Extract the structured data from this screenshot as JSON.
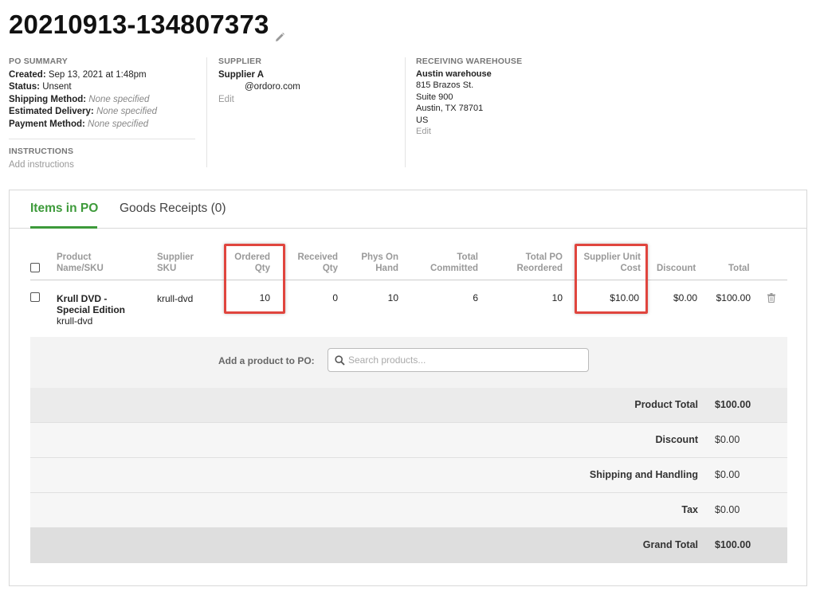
{
  "po": {
    "number": "20210913-134807373",
    "summary": {
      "heading": "PO SUMMARY",
      "created_label": "Created:",
      "created_value": "Sep 13, 2021 at 1:48pm",
      "status_label": "Status:",
      "status_value": "Unsent",
      "shipping_label": "Shipping Method:",
      "shipping_value": "None specified",
      "delivery_label": "Estimated Delivery:",
      "delivery_value": "None specified",
      "payment_label": "Payment Method:",
      "payment_value": "None specified"
    },
    "instructions": {
      "heading": "INSTRUCTIONS",
      "link": "Add instructions"
    },
    "supplier": {
      "heading": "SUPPLIER",
      "name": "Supplier A",
      "email": "@ordoro.com",
      "edit": "Edit"
    },
    "warehouse": {
      "heading": "RECEIVING WAREHOUSE",
      "name": "Austin warehouse",
      "line1": "815 Brazos St.",
      "line2": "Suite 900",
      "line3": "Austin, TX 78701",
      "line4": "US",
      "edit": "Edit"
    }
  },
  "tabs": [
    {
      "label": "Items in PO",
      "active": true
    },
    {
      "label": "Goods Receipts (0)",
      "active": false
    }
  ],
  "table": {
    "headers": {
      "product_1": "Product",
      "product_2": "Name/SKU",
      "supplier_sku_1": "Supplier",
      "supplier_sku_2": "SKU",
      "ordered_1": "Ordered",
      "ordered_2": "Qty",
      "received_1": "Received",
      "received_2": "Qty",
      "phys_1": "Phys On",
      "phys_2": "Hand",
      "committed_1": "Total",
      "committed_2": "Committed",
      "reordered_1": "Total PO",
      "reordered_2": "Reordered",
      "unit_cost_1": "Supplier Unit",
      "unit_cost_2": "Cost",
      "discount": "Discount",
      "total": "Total"
    },
    "rows": [
      {
        "name_1": "Krull DVD -",
        "name_2": "Special Edition",
        "sku": "krull-dvd",
        "supplier_sku": "krull-dvd",
        "ordered_qty": "10",
        "received_qty": "0",
        "phys_on_hand": "10",
        "total_committed": "6",
        "total_po_reordered": "10",
        "unit_cost": "$10.00",
        "discount": "$0.00",
        "total": "$100.00"
      }
    ]
  },
  "add_product": {
    "label": "Add a product to PO:",
    "placeholder": "Search products..."
  },
  "totals": {
    "product_total_label": "Product Total",
    "product_total_value": "$100.00",
    "discount_label": "Discount",
    "discount_value": "$0.00",
    "shipping_label": "Shipping and Handling",
    "shipping_value": "$0.00",
    "tax_label": "Tax",
    "tax_value": "$0.00",
    "grand_total_label": "Grand Total",
    "grand_total_value": "$100.00"
  },
  "colors": {
    "accent_green": "#3d9a3a",
    "highlight_red": "#e0453e"
  },
  "icons": [
    "pencil-icon",
    "search-icon",
    "trash-icon"
  ]
}
